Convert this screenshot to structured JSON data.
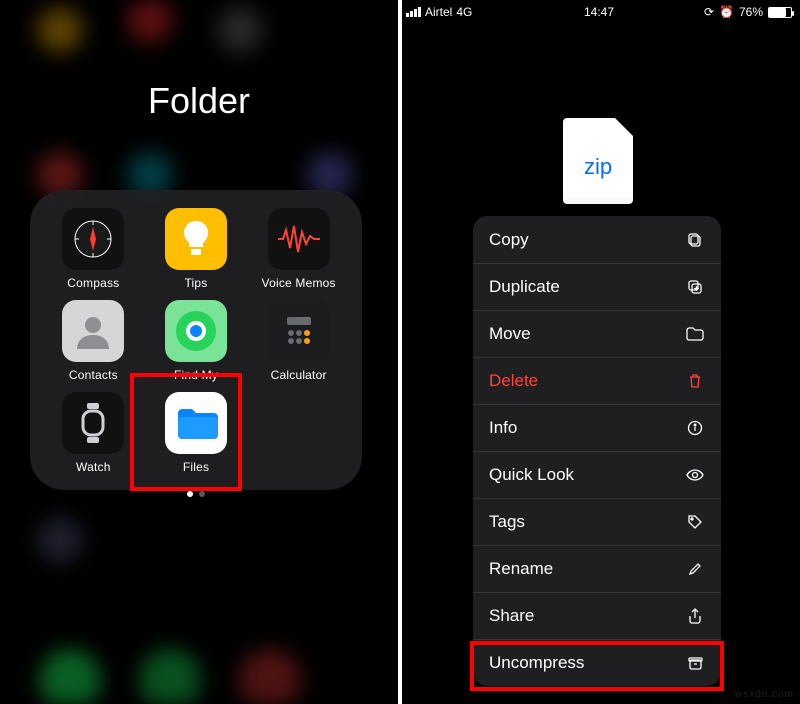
{
  "left": {
    "folder_title": "Folder",
    "apps": [
      {
        "name": "compass",
        "label": "Compass"
      },
      {
        "name": "tips",
        "label": "Tips"
      },
      {
        "name": "voice",
        "label": "Voice Memos"
      },
      {
        "name": "contacts",
        "label": "Contacts"
      },
      {
        "name": "findmy",
        "label": "Find My"
      },
      {
        "name": "calculator",
        "label": "Calculator"
      },
      {
        "name": "watch",
        "label": "Watch"
      },
      {
        "name": "files",
        "label": "Files"
      }
    ],
    "highlighted_app": "Files"
  },
  "right": {
    "status": {
      "carrier": "Airtel",
      "network": "4G",
      "time": "14:47",
      "alarm": true,
      "battery_percent": "76%"
    },
    "file": {
      "type_label": "zip"
    },
    "context_menu": [
      {
        "key": "copy",
        "label": "Copy",
        "icon": "copy-icon",
        "danger": false
      },
      {
        "key": "duplicate",
        "label": "Duplicate",
        "icon": "duplicate-icon",
        "danger": false
      },
      {
        "key": "move",
        "label": "Move",
        "icon": "folder-icon",
        "danger": false
      },
      {
        "key": "delete",
        "label": "Delete",
        "icon": "trash-icon",
        "danger": true
      },
      {
        "key": "info",
        "label": "Info",
        "icon": "info-icon",
        "danger": false
      },
      {
        "key": "quick_look",
        "label": "Quick Look",
        "icon": "eye-icon",
        "danger": false
      },
      {
        "key": "tags",
        "label": "Tags",
        "icon": "tag-icon",
        "danger": false
      },
      {
        "key": "rename",
        "label": "Rename",
        "icon": "pencil-icon",
        "danger": false
      },
      {
        "key": "share",
        "label": "Share",
        "icon": "share-icon",
        "danger": false
      },
      {
        "key": "uncompress",
        "label": "Uncompress",
        "icon": "archive-icon",
        "danger": false
      }
    ],
    "highlighted_action": "Uncompress"
  },
  "watermark": "wsxdn.com"
}
